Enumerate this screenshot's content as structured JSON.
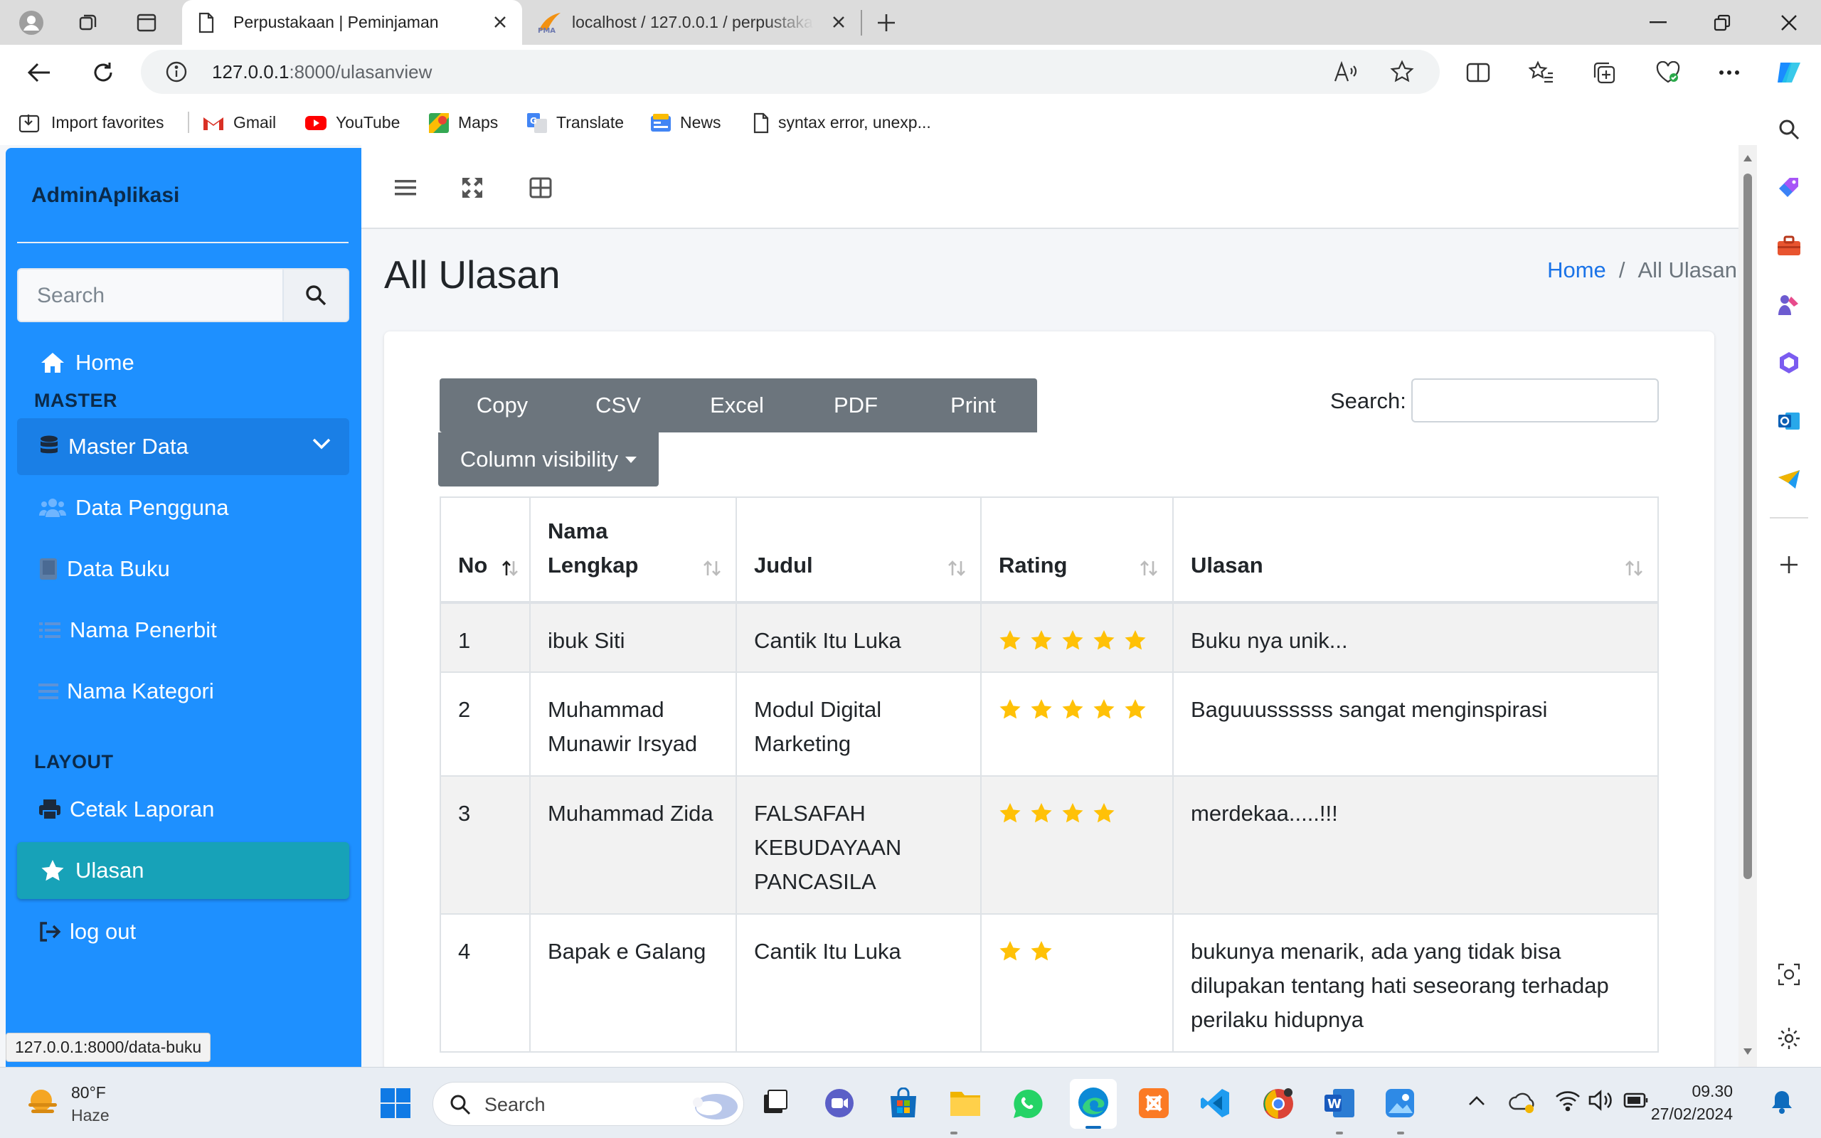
{
  "browser": {
    "tabs": [
      {
        "title": "Perpustakaan | Peminjaman",
        "active": true
      },
      {
        "title": "localhost / 127.0.0.1 / perpustaka",
        "active": false
      }
    ],
    "address": {
      "host": "127.0.0.1",
      "path": ":8000/ulasanview"
    },
    "favorites": [
      "Import favorites",
      "Gmail",
      "YouTube",
      "Maps",
      "Translate",
      "News",
      "syntax error, unexp..."
    ]
  },
  "sidebar": {
    "brand": "AdminAplikasi",
    "search_placeholder": "Search",
    "home": "Home",
    "section_master": "MASTER",
    "master_data": "Master Data",
    "sub_items": [
      "Data Pengguna",
      "Data Buku",
      "Nama Penerbit",
      "Nama Kategori"
    ],
    "section_layout": "LAYOUT",
    "cetak": "Cetak Laporan",
    "ulasan": "Ulasan",
    "logout": "log out"
  },
  "status_url": "127.0.0.1:8000/data-buku",
  "main": {
    "title": "All Ulasan",
    "breadcrumb": {
      "home": "Home",
      "sep": "/",
      "current": "All Ulasan"
    }
  },
  "datatable": {
    "buttons": [
      "Copy",
      "CSV",
      "Excel",
      "PDF",
      "Print"
    ],
    "column_visibility": "Column visibility",
    "search_label": "Search:",
    "columns": [
      "No",
      "Nama Lengkap",
      "Judul",
      "Rating",
      "Ulasan"
    ],
    "rows": [
      {
        "no": "1",
        "nama": "ibuk Siti",
        "judul": "Cantik Itu Luka",
        "rating": 5,
        "ulasan": "Buku nya unik..."
      },
      {
        "no": "2",
        "nama": "Muhammad Munawir Irsyad",
        "judul": "Modul Digital Marketing",
        "rating": 5,
        "ulasan": "Baguuussssss sangat menginspirasi"
      },
      {
        "no": "3",
        "nama": "Muhammad Zida",
        "judul": "FALSAFAH KEBUDAYAAN PANCASILA",
        "rating": 4,
        "ulasan": "merdekaa.....!!!"
      },
      {
        "no": "4",
        "nama": "Bapak e Galang",
        "judul": "Cantik Itu Luka",
        "rating": 2,
        "ulasan": "bukunya menarik, ada yang tidak bisa dilupakan tentang hati seseorang terhadap perilaku hidupnya"
      }
    ]
  },
  "taskbar": {
    "weather_temp": "80°F",
    "weather_desc": "Haze",
    "search_placeholder": "Search",
    "time": "09.30",
    "date": "27/02/2024"
  },
  "colors": {
    "sidebar": "#1e90ff",
    "active_item": "#17a2b8",
    "button": "#6c757d",
    "star": "#ffc107",
    "link": "#1a73e8"
  }
}
